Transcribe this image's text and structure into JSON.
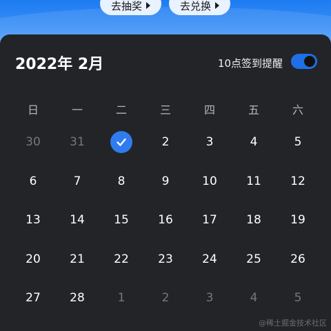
{
  "top_buttons": {
    "lottery": "去抽奖",
    "exchange": "去兑换"
  },
  "calendar": {
    "title": "2022年 2月",
    "reminder_label": "10点签到提醒",
    "reminder_enabled": true,
    "accent_color": "#2f7cf0",
    "weekdays": [
      "日",
      "一",
      "二",
      "三",
      "四",
      "五",
      "六"
    ],
    "weeks": [
      [
        {
          "d": "30",
          "muted": true
        },
        {
          "d": "31",
          "muted": true
        },
        {
          "d": "",
          "checked": true
        },
        {
          "d": "2"
        },
        {
          "d": "3"
        },
        {
          "d": "4"
        },
        {
          "d": "5"
        }
      ],
      [
        {
          "d": "6"
        },
        {
          "d": "7"
        },
        {
          "d": "8"
        },
        {
          "d": "9"
        },
        {
          "d": "10"
        },
        {
          "d": "11"
        },
        {
          "d": "12"
        }
      ],
      [
        {
          "d": "13"
        },
        {
          "d": "14"
        },
        {
          "d": "15"
        },
        {
          "d": "16"
        },
        {
          "d": "17"
        },
        {
          "d": "18"
        },
        {
          "d": "19"
        }
      ],
      [
        {
          "d": "20"
        },
        {
          "d": "21"
        },
        {
          "d": "22"
        },
        {
          "d": "23"
        },
        {
          "d": "24"
        },
        {
          "d": "25"
        },
        {
          "d": "26"
        }
      ],
      [
        {
          "d": "27"
        },
        {
          "d": "28"
        },
        {
          "d": "1",
          "muted": true
        },
        {
          "d": "2",
          "muted": true
        },
        {
          "d": "3",
          "muted": true
        },
        {
          "d": "4",
          "muted": true
        },
        {
          "d": "5",
          "muted": true
        }
      ]
    ]
  },
  "watermark": "@稀土掘金技术社区"
}
